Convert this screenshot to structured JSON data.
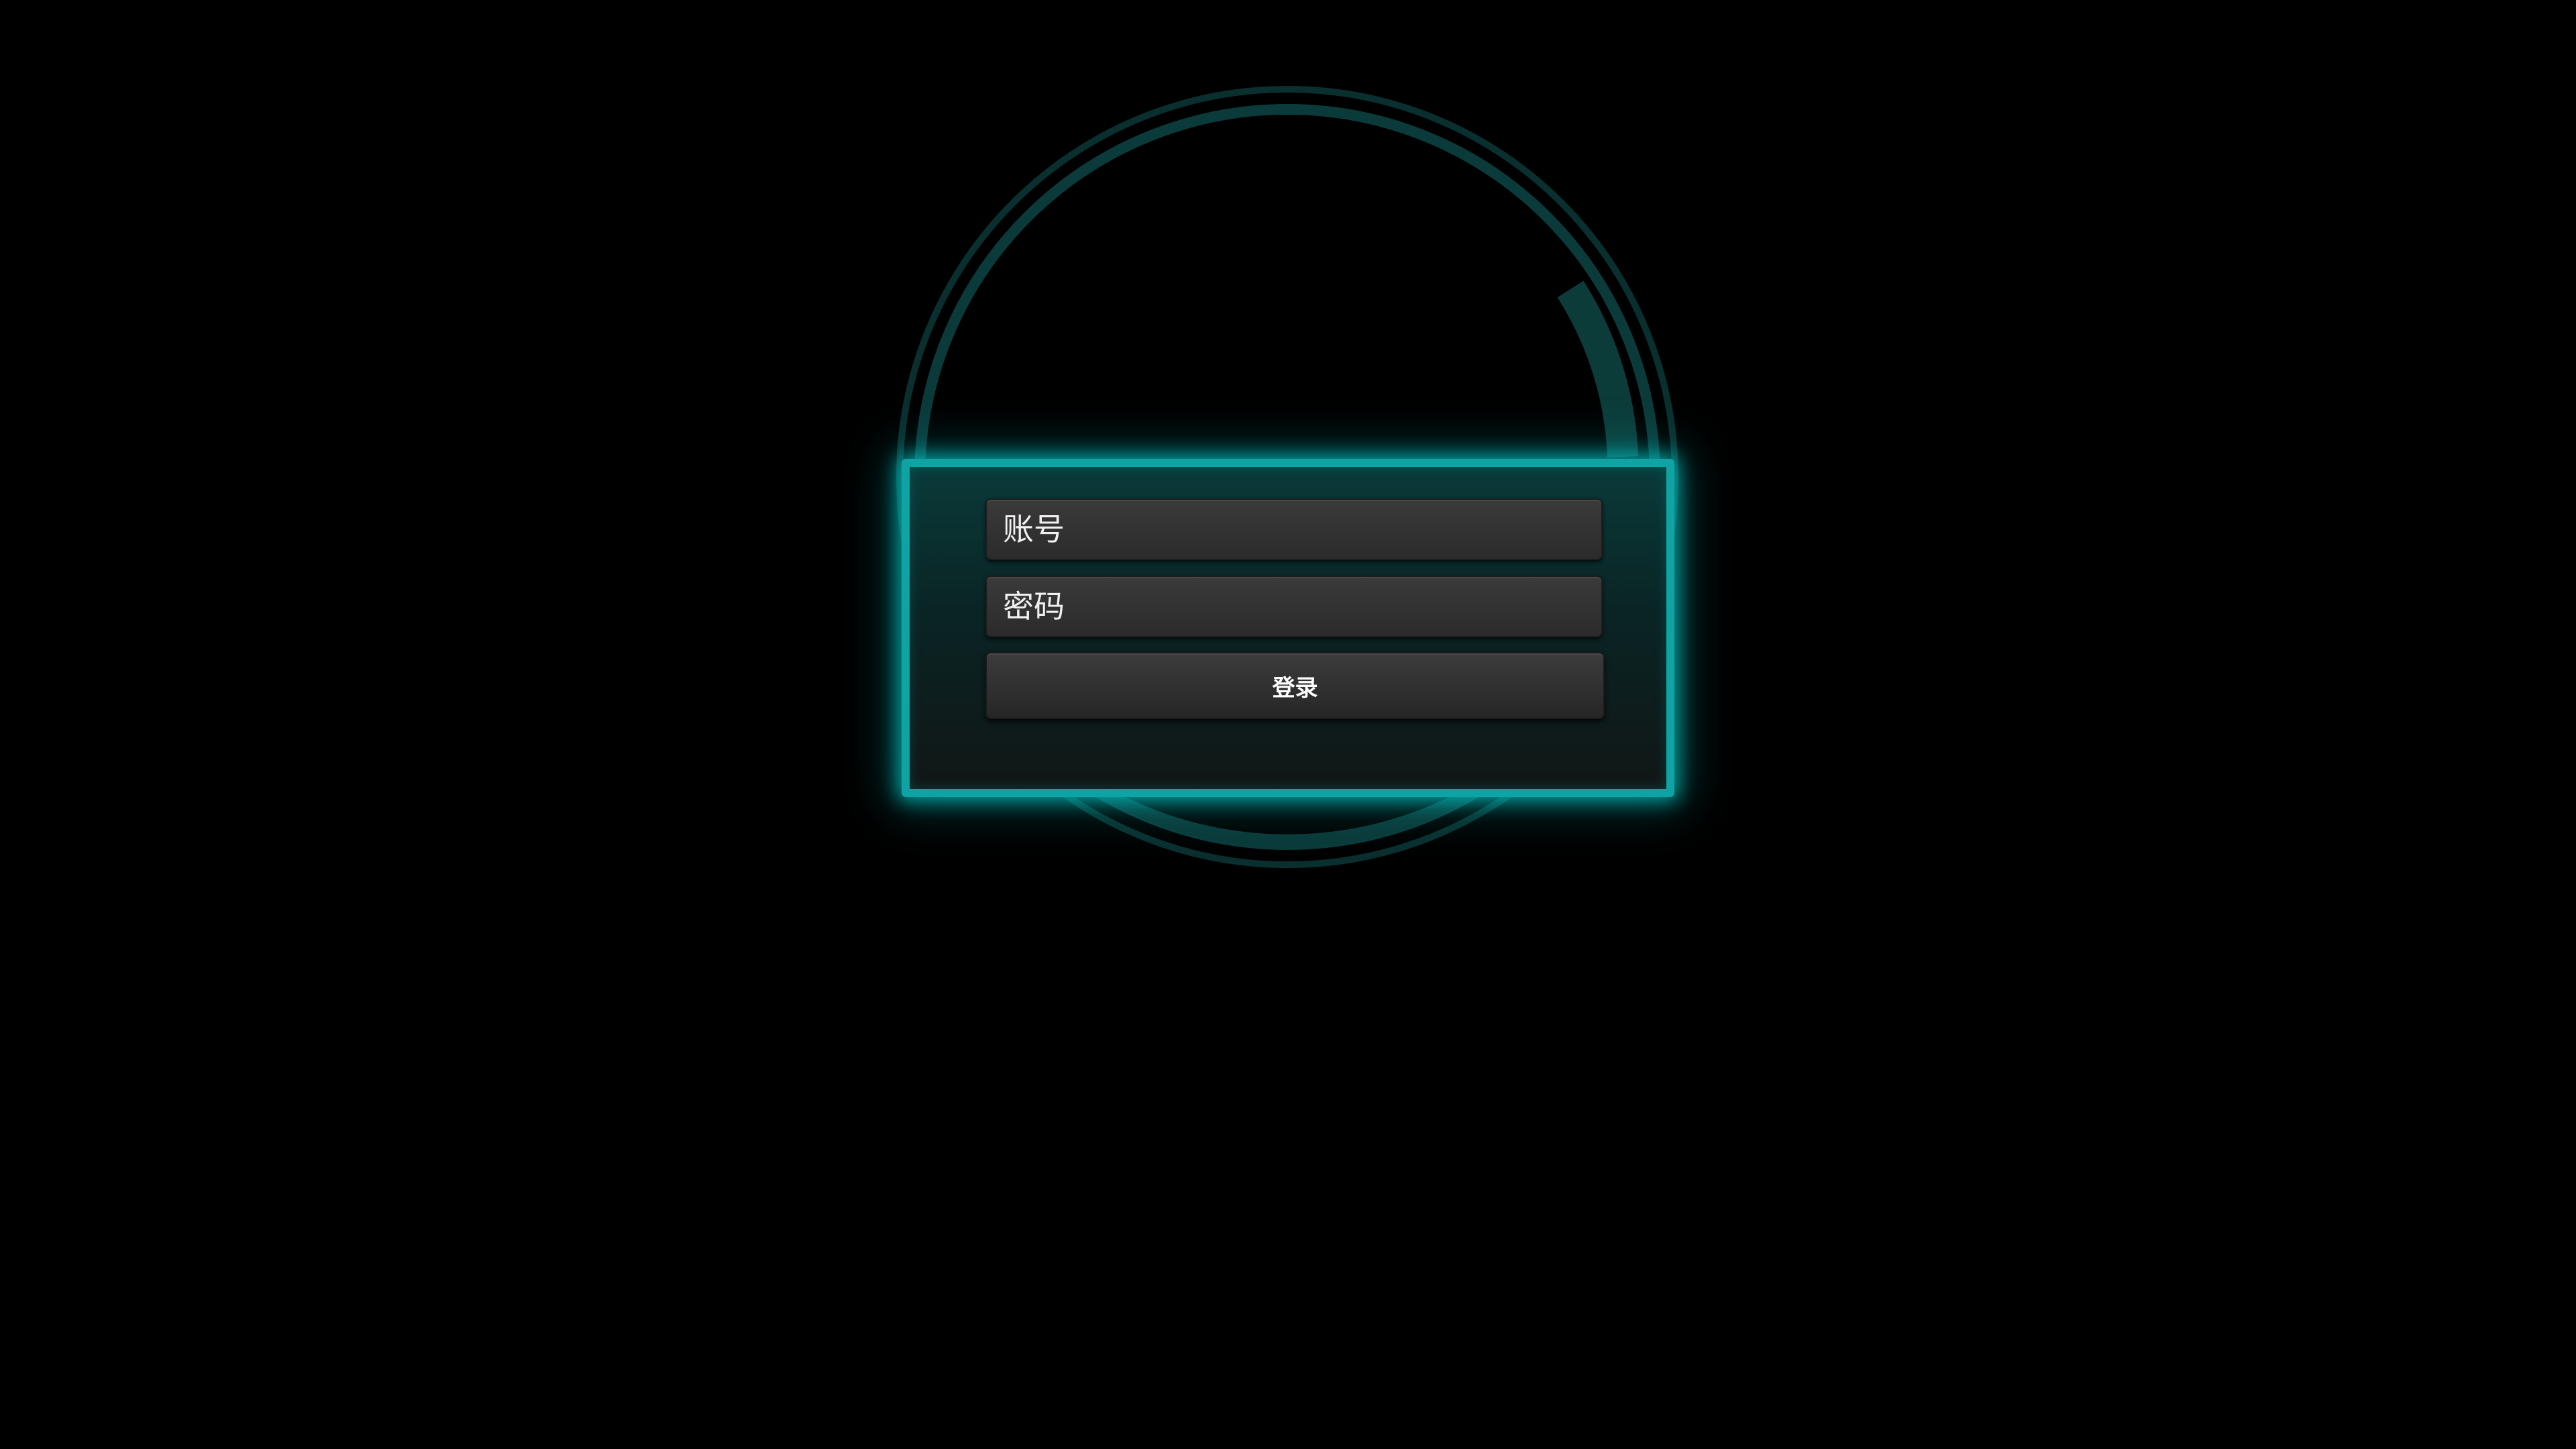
{
  "login_form": {
    "account_placeholder": "账号",
    "password_placeholder": "密码",
    "login_label": "登录"
  },
  "theme": {
    "background": "#000000",
    "accent": "#0fa3a3",
    "ring": "#0b3a3a"
  }
}
